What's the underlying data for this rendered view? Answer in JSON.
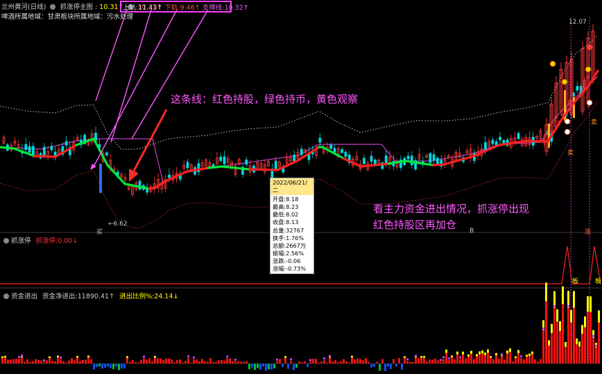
{
  "title": "兰州黄河(日线)",
  "indicator_main": "抓涨停主图",
  "price_a": "10.31↑",
  "price_b": "10.31↑",
  "band": {
    "upper_label": "上轨:",
    "upper_val": "11.43↑",
    "lower_label": "下轨:",
    "lower_val": "9.46↑",
    "support_label": "支撑线:",
    "support_val": "10.32↑"
  },
  "sector_line": "啤酒所属地域：甘肃板块所属地域：污水处理",
  "price_labels": {
    "high": "12.07",
    "low": "←6.62",
    "buy_tag": "买",
    "sell_tag": "卖",
    "close_tag": "卖",
    "b_tag": "B"
  },
  "annotation_top": "这条线：红色持股，绿色持币，黄色观察",
  "annotation_bottom_1": "看主力资金进出情况，抓涨停出现",
  "annotation_bottom_2": "红色持股区再加仓",
  "tooltip": {
    "date": "2022/06/21/二",
    "rows": [
      "开盘:8.18",
      "最高:8.23",
      "最低:8.02",
      "收盘:8.13",
      "总量:32767",
      "换手:1.76%",
      "总额:2667万",
      "振幅:2.56%",
      "涨跌:-0.06",
      "涨幅:-0.73%"
    ]
  },
  "panel2": {
    "name": "抓涨停",
    "label": "抓涨停:",
    "value": "0.00↓",
    "tags": [
      "涨",
      "板",
      "板"
    ]
  },
  "panel3": {
    "name": "资金进出",
    "net_label": "资金净进出:",
    "net_value": "11890.41↑",
    "ratio_label": "进出比例%:",
    "ratio_value": "24.14↓"
  },
  "colors": {
    "hold": "#ff2020",
    "cash": "#00e83a",
    "watch": "#ffff00",
    "upper_band": "#ffffff",
    "support": "#c040c0",
    "lower_band": "#c03030",
    "annotation": "#ff59ff",
    "highlight_box": "#ff40ff"
  },
  "icons": [
    "circle-icon",
    "arrow-icon",
    "flame-icon"
  ]
}
